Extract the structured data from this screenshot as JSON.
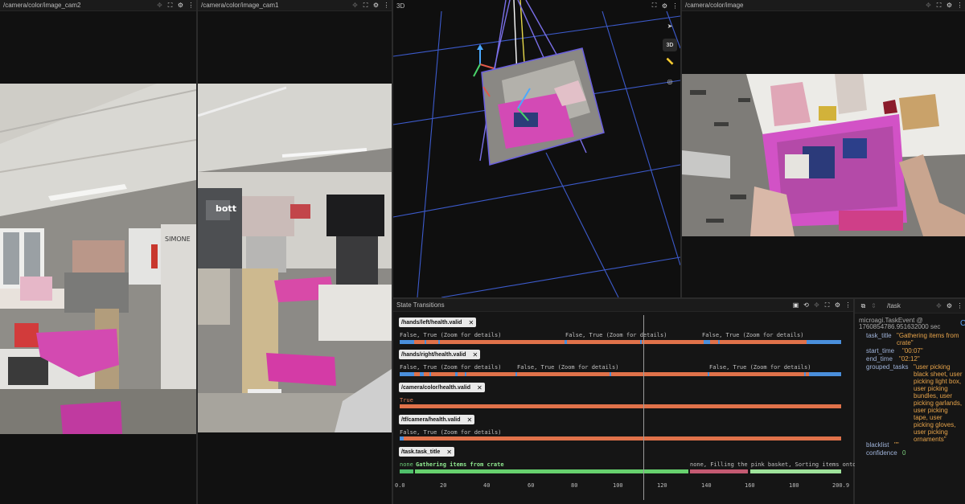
{
  "panels": {
    "cam2": {
      "title": "/camera/color/image_cam2"
    },
    "cam1": {
      "title": "/camera/color/image_cam1"
    },
    "view3d": {
      "title": "3D",
      "mode_label": "3D"
    },
    "cam": {
      "title": "/camera/color/image"
    },
    "state": {
      "title": "State Transitions"
    },
    "task": {
      "title": "/task"
    }
  },
  "state_rows": [
    {
      "topic": "/hands/left/health.valid",
      "labels": [
        "False, True (Zoom for details)",
        "False, True (Zoom for details)",
        "False, True (Zoom for details)"
      ]
    },
    {
      "topic": "/hands/right/health.valid",
      "labels": [
        "False, True (Zoom for details)",
        "False, True (Zoom for details)",
        "False, True (Zoom for details)"
      ]
    },
    {
      "topic": "/camera/color/health.valid",
      "labels": [
        "True"
      ]
    },
    {
      "topic": "/tf/camera/health.valid",
      "labels": [
        "False, True (Zoom for details)"
      ]
    },
    {
      "topic": "/task.task_title",
      "labels": [
        "none",
        "Gathering items from crate",
        "none, Filling the pink basket, Sorting items onto tabl"
      ]
    }
  ],
  "axis_ticks": [
    "0.0",
    "20",
    "40",
    "60",
    "80",
    "100",
    "120",
    "140",
    "160",
    "180",
    "200.9"
  ],
  "task": {
    "header": "microagi.TaskEvent @",
    "timestamp": "1760854786.951632000 sec",
    "fields": [
      {
        "key": "task_title",
        "value": "\"Gathering items from crate\""
      },
      {
        "key": "start_time",
        "value": "\"00:07\""
      },
      {
        "key": "end_time",
        "value": "\"02:12\""
      },
      {
        "key": "grouped_tasks",
        "value": "\"user picking black sheet, user picking light box, user picking bundles, user picking garlands, user picking tape, user picking gloves, user picking ornaments\""
      },
      {
        "key": "blacklist",
        "value": "\"\""
      },
      {
        "key": "confidence",
        "value": "0"
      }
    ]
  },
  "colors": {
    "valid_true": "#e0724a",
    "valid_false": "#4a8fdc",
    "task_none": "#4fbf6a",
    "task_gather": "#67d16e",
    "task_fill": "#c45a72",
    "task_sort": "#9ee29a",
    "grid": "#3f5fd6"
  },
  "scene_text": {
    "logo": "bott",
    "sign": "SIMONE"
  }
}
